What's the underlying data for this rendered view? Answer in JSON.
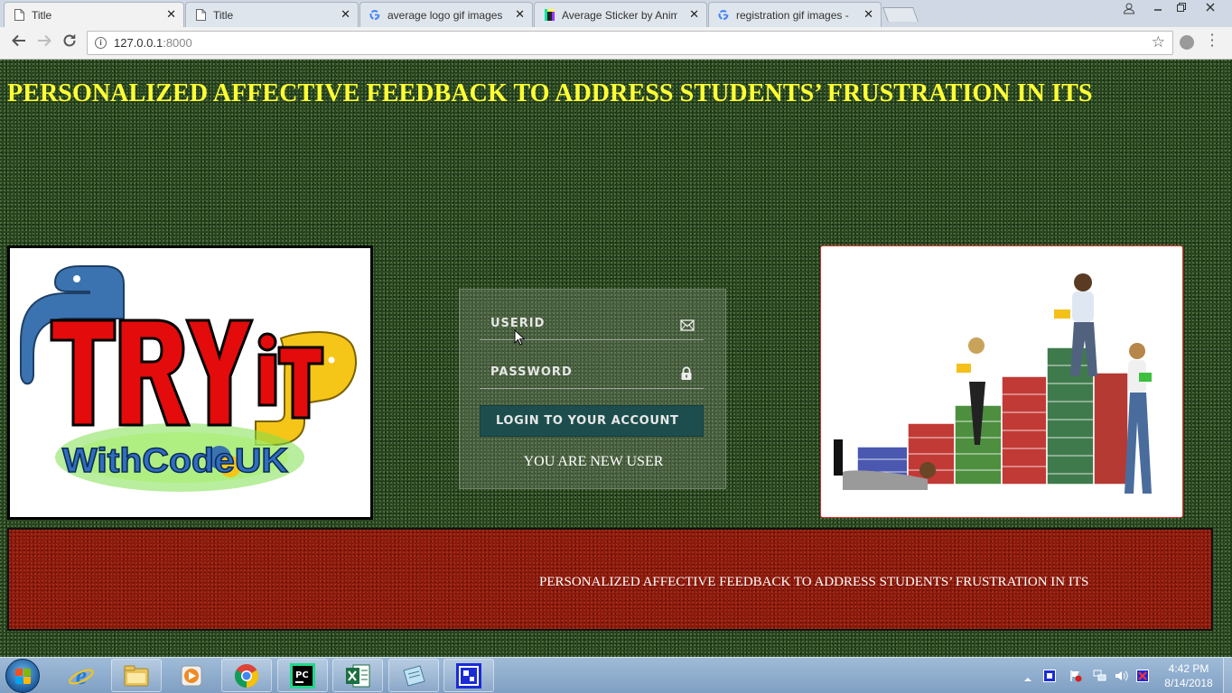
{
  "browser": {
    "tabs": [
      {
        "title": "Title",
        "active": true
      },
      {
        "title": "Title",
        "active": false
      },
      {
        "title": "average logo gif images",
        "active": false
      },
      {
        "title": "Average Sticker by Anima",
        "active": false
      },
      {
        "title": "registration gif images - G",
        "active": false
      }
    ],
    "close_glyph": "✕",
    "url_host": "127.0.0.1",
    "url_port": ":8000"
  },
  "page": {
    "headline": "PERSONALIZED AFFECTIVE FEEDBACK TO ADDRESS STUDENTS’ FRUSTRATION IN ITS",
    "logo_text": {
      "line1": "TRY it",
      "line2": "WithCodeUK"
    },
    "login": {
      "userid_placeholder": "USERID",
      "password_placeholder": "PASSWORD",
      "login_button": "LOGIN TO YOUR ACCOUNT",
      "new_user_link": "YOU ARE NEW USER"
    },
    "marquee_text": "PERSONALIZED AFFECTIVE FEEDBACK TO ADDRESS STUDENTS’ FRUSTRATION IN ITS"
  },
  "taskbar": {
    "apps": [
      "internet-explorer",
      "file-explorer",
      "media-player",
      "chrome",
      "pycharm",
      "excel",
      "notepad",
      "remote-app"
    ],
    "pycharm_label": "PC",
    "clock_time": "4:42 PM",
    "clock_date": "8/14/2018"
  },
  "colors": {
    "headline": "#ffff33",
    "login_button": "#1d4e4d",
    "footer_band": "#8a1a0c",
    "page_background": "#24401c"
  }
}
